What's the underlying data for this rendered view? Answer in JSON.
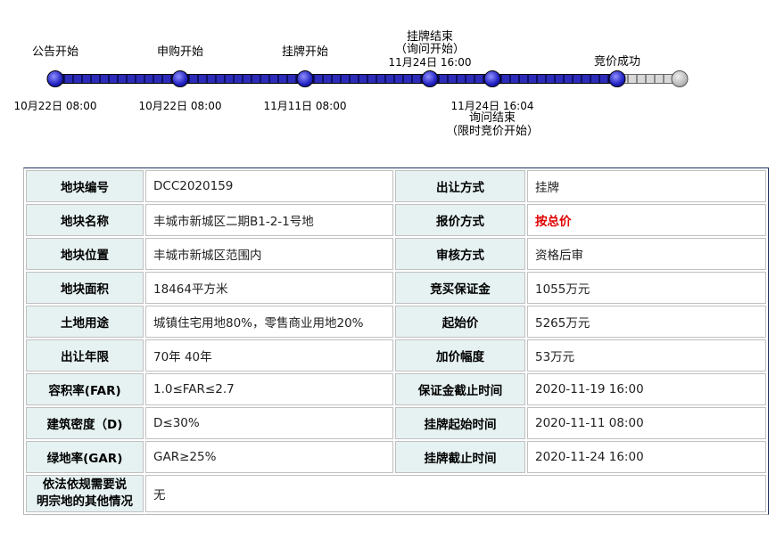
{
  "timeline": {
    "events": [
      {
        "label": "公告开始",
        "date": "10月22日 08:00",
        "status": "done"
      },
      {
        "label": "申购开始",
        "date": "10月22日 08:00",
        "status": "done"
      },
      {
        "label": "挂牌开始",
        "date": "11月11日 08:00",
        "status": "done"
      },
      {
        "label_line1": "挂牌结束",
        "label_line2": "（询问开始）",
        "date": "11月24日 16:00",
        "status": "done"
      },
      {
        "label_line1": "询问结束",
        "label_line2": "（限时竞价开始）",
        "date": "11月24日 16:04",
        "status": "done"
      },
      {
        "label": "竞价成功",
        "status": "done"
      },
      {
        "status": "todo"
      }
    ]
  },
  "info": {
    "rows": [
      {
        "k1": "地块编号",
        "v1": "DCC2020159",
        "k2": "出让方式",
        "v2": "挂牌"
      },
      {
        "k1": "地块名称",
        "v1": "丰城市新城区二期B1-2-1号地",
        "k2": "报价方式",
        "v2": "按总价"
      },
      {
        "k1": "地块位置",
        "v1": "丰城市新城区范围内",
        "k2": "审核方式",
        "v2": "资格后审"
      },
      {
        "k1": "地块面积",
        "v1": "18464平方米",
        "k2": "竞买保证金",
        "v2": "1055万元"
      },
      {
        "k1": "土地用途",
        "v1": "城镇住宅用地80%，零售商业用地20%",
        "k2": "起始价",
        "v2": "5265万元"
      },
      {
        "k1": "出让年限",
        "v1": "70年 40年",
        "k2": "加价幅度",
        "v2": "53万元"
      },
      {
        "k1": "容积率(FAR)",
        "v1": "1.0≤FAR≤2.7",
        "k2": "保证金截止时间",
        "v2": "2020-11-19 16:00"
      },
      {
        "k1": "建筑密度（D)",
        "v1": "D≤30%",
        "k2": "挂牌起始时间",
        "v2": "2020-11-11 08:00"
      },
      {
        "k1": "绿地率(GAR)",
        "v1": "GAR≥25%",
        "k2": "挂牌截止时间",
        "v2": "2020-11-24 16:00"
      }
    ],
    "last_row": {
      "k1_line1": "依法依规需要说",
      "k1_line2": "明宗地的其他情况",
      "v1": "无"
    }
  },
  "colors": {
    "progress_done": "#3333cc",
    "progress_todo": "#cccccc",
    "key_bg": "#e6f1f1",
    "highlight": "#e00000"
  }
}
